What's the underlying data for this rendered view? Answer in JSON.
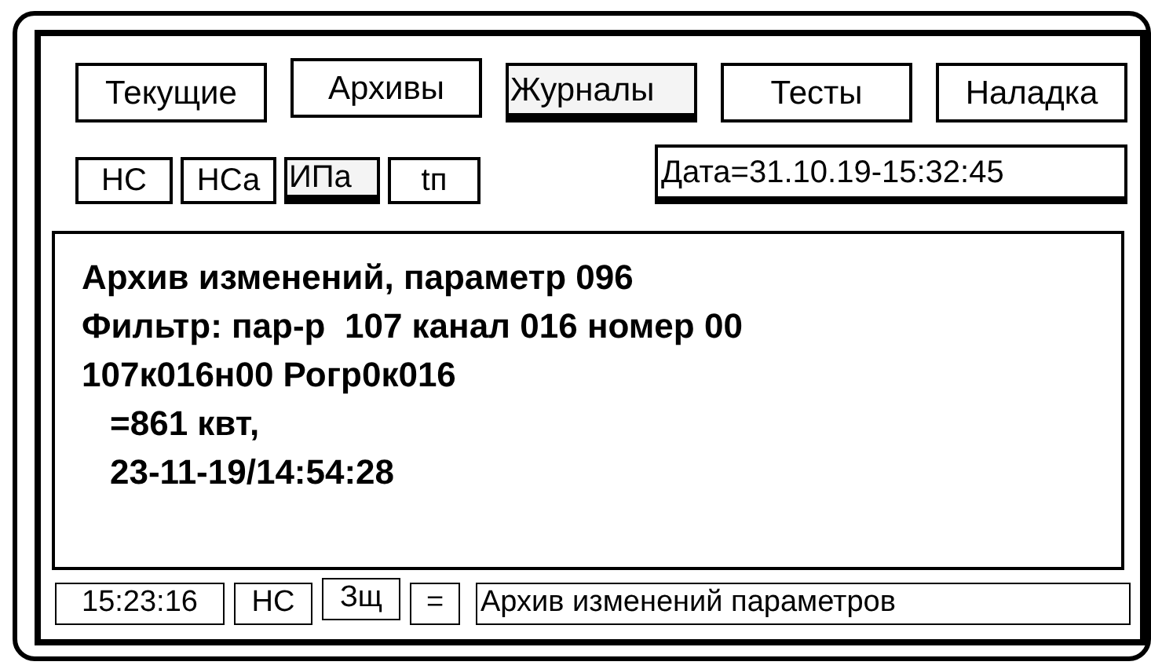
{
  "tabs": [
    {
      "label": "Текущие",
      "selected": false
    },
    {
      "label": "Архивы",
      "selected": false
    },
    {
      "label": "Журналы",
      "selected": true
    },
    {
      "label": "Тесты",
      "selected": false
    },
    {
      "label": "Наладка",
      "selected": false
    }
  ],
  "subtabs": [
    {
      "label": "НС",
      "selected": false
    },
    {
      "label": "НСа",
      "selected": false
    },
    {
      "label": "ИПа",
      "selected": true
    },
    {
      "label": "tп",
      "selected": false
    }
  ],
  "date_field": "Дата=31.10.19-15:32:45",
  "content_lines": [
    {
      "text": "Архив изменений, параметр 096",
      "indent": false
    },
    {
      "text": "Фильтр: пар-р  107 канал 016 номер 00",
      "indent": false
    },
    {
      "text": "107к016н00 Рогр0к016",
      "indent": false
    },
    {
      "text": "=861 квт,",
      "indent": true
    },
    {
      "text": "23-11-19/14:54:28",
      "indent": true
    }
  ],
  "status_bar": {
    "time": "15:23:16",
    "mode": "НС",
    "protection": "Зщ",
    "sign": "=",
    "message": "Архив изменений параметров"
  }
}
